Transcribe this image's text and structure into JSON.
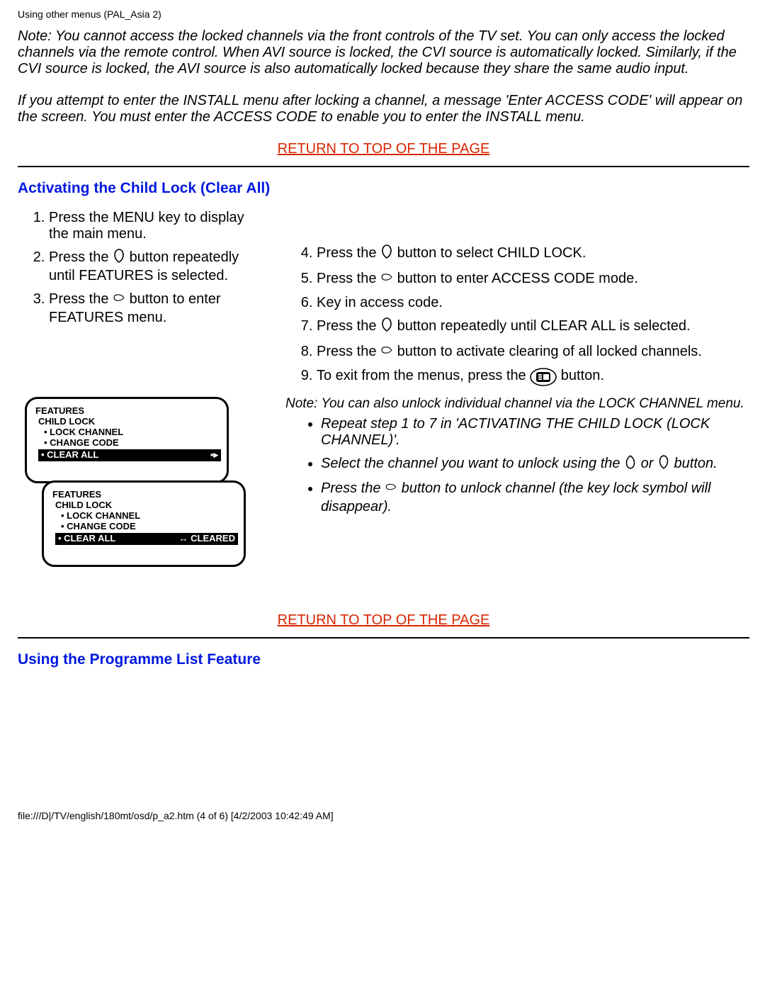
{
  "header": "Using other menus (PAL_Asia 2)",
  "note1": "Note: You cannot access the locked channels via the front controls of the TV set. You can only access the locked channels via the remote control. When AVI source is locked, the CVI source is automatically locked. Similarly, if the CVI source is locked, the AVI source is also automatically locked because they share the same audio input.",
  "note2": "If you attempt to enter the INSTALL menu after locking a channel, a message 'Enter ACCESS CODE' will appear on the screen. You must enter the ACCESS CODE to enable you to enter the INSTALL menu.",
  "return_link": "RETURN TO TOP OF THE PAGE",
  "heading1": "Activating the Child Lock (Clear All)",
  "steps_left": {
    "s1": "Press the MENU key to display the main menu.",
    "s2a": "Press the ",
    "s2b": " button repeatedly until FEATURES is selected.",
    "s3a": "Press the ",
    "s3b": " button to enter FEATURES menu."
  },
  "steps_right": {
    "s4a": "Press the ",
    "s4b": " button to select CHILD LOCK.",
    "s5a": "Press the ",
    "s5b": " button to enter ACCESS CODE mode.",
    "s6": "Key in access code.",
    "s7a": "Press the ",
    "s7b": " button repeatedly until CLEAR ALL is selected.",
    "s8a": "Press the ",
    "s8b": " button to activate clearing of all locked channels.",
    "s9a": "To exit from the menus, press the ",
    "s9b": " button."
  },
  "sub_note": "Note: You can also unlock individual channel via the LOCK CHANNEL menu.",
  "bullets": {
    "b1": "Repeat step 1 to 7 in 'ACTIVATING THE CHILD LOCK (LOCK CHANNEL)'.",
    "b2a": "Select the channel you want to unlock using the ",
    "b2b": " or ",
    "b2c": " button.",
    "b3a": "Press the ",
    "b3b": " button to unlock channel (the key lock symbol will disappear)."
  },
  "heading2": "Using the Programme List Feature",
  "footer": "file:///D|/TV/english/180mt/osd/p_a2.htm (4 of 6) [4/2/2003 10:42:49 AM]",
  "osd": {
    "features": "FEATURES",
    "childlock": "CHILD LOCK",
    "lock_channel": "• LOCK CHANNEL",
    "change_code": "• CHANGE CODE",
    "clear_all": "• CLEAR ALL",
    "arrows": "▪▸",
    "cleared": "↔ CLEARED"
  }
}
